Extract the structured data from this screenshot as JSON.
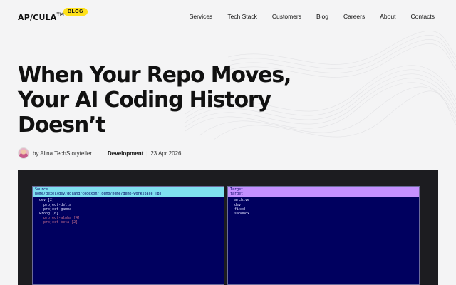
{
  "brand": {
    "logo": "AP/CULA",
    "trademark": "TM",
    "badge": "BLOG"
  },
  "nav": [
    "Services",
    "Tech Stack",
    "Customers",
    "Blog",
    "Careers",
    "About",
    "Contacts"
  ],
  "article": {
    "title_lines": [
      "When Your Repo Moves,",
      "Your AI Coding History",
      "Doesn’t"
    ],
    "author": "by Alina TechStoryteller",
    "category": "Development",
    "separator": "|",
    "date": "23 Apr 2026"
  },
  "terminal": {
    "left": {
      "header": "Source",
      "path": "home/dexel/dev/golang/codexom/.demo/home/demo-workspace [8]",
      "tree": [
        {
          "text": "dev [2]",
          "level": 1,
          "dim": false
        },
        {
          "text": "project-delta",
          "level": 2,
          "dim": false
        },
        {
          "text": "project-gamma",
          "level": 2,
          "dim": false
        },
        {
          "text": "wrong [6]",
          "level": 1,
          "dim": false
        },
        {
          "text": "project-alpha [4]",
          "level": 2,
          "dim": true
        },
        {
          "text": "project-beta [2]",
          "level": 2,
          "dim": true
        }
      ]
    },
    "right": {
      "header": "Target",
      "subheader": "target",
      "tree": [
        {
          "text": "archive",
          "level": 1,
          "dim": false
        },
        {
          "text": "dev",
          "level": 1,
          "dim": false
        },
        {
          "text": "fixed",
          "level": 1,
          "dim": false
        },
        {
          "text": "sandbox",
          "level": 1,
          "dim": false
        }
      ]
    }
  }
}
